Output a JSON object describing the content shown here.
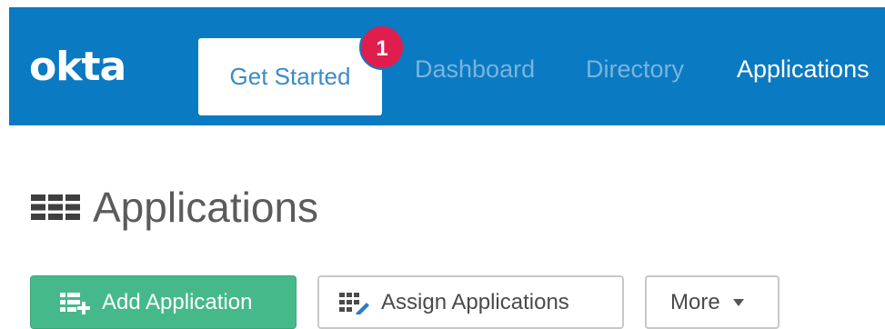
{
  "header": {
    "logo": "okta",
    "get_started": {
      "label": "Get Started",
      "badge": "1"
    },
    "nav": [
      {
        "label": "Dashboard"
      },
      {
        "label": "Directory"
      },
      {
        "label": "Applications"
      }
    ]
  },
  "main": {
    "title": "Applications",
    "title_icon": "grid-icon"
  },
  "toolbar": {
    "add_application": {
      "label": "Add Application",
      "icon": "add-list-icon"
    },
    "assign_applications": {
      "label": "Assign Applications",
      "icon": "assign-grid-icon"
    },
    "more": {
      "label": "More",
      "icon": "chevron-down-icon"
    }
  },
  "colors": {
    "nav_bg": "#0a7ac2",
    "nav_inactive": "#7ab4de",
    "nav_active": "#ffffff",
    "badge": "#e01e4e",
    "primary_button": "#46b98a",
    "title_text": "#5b5b5b"
  }
}
